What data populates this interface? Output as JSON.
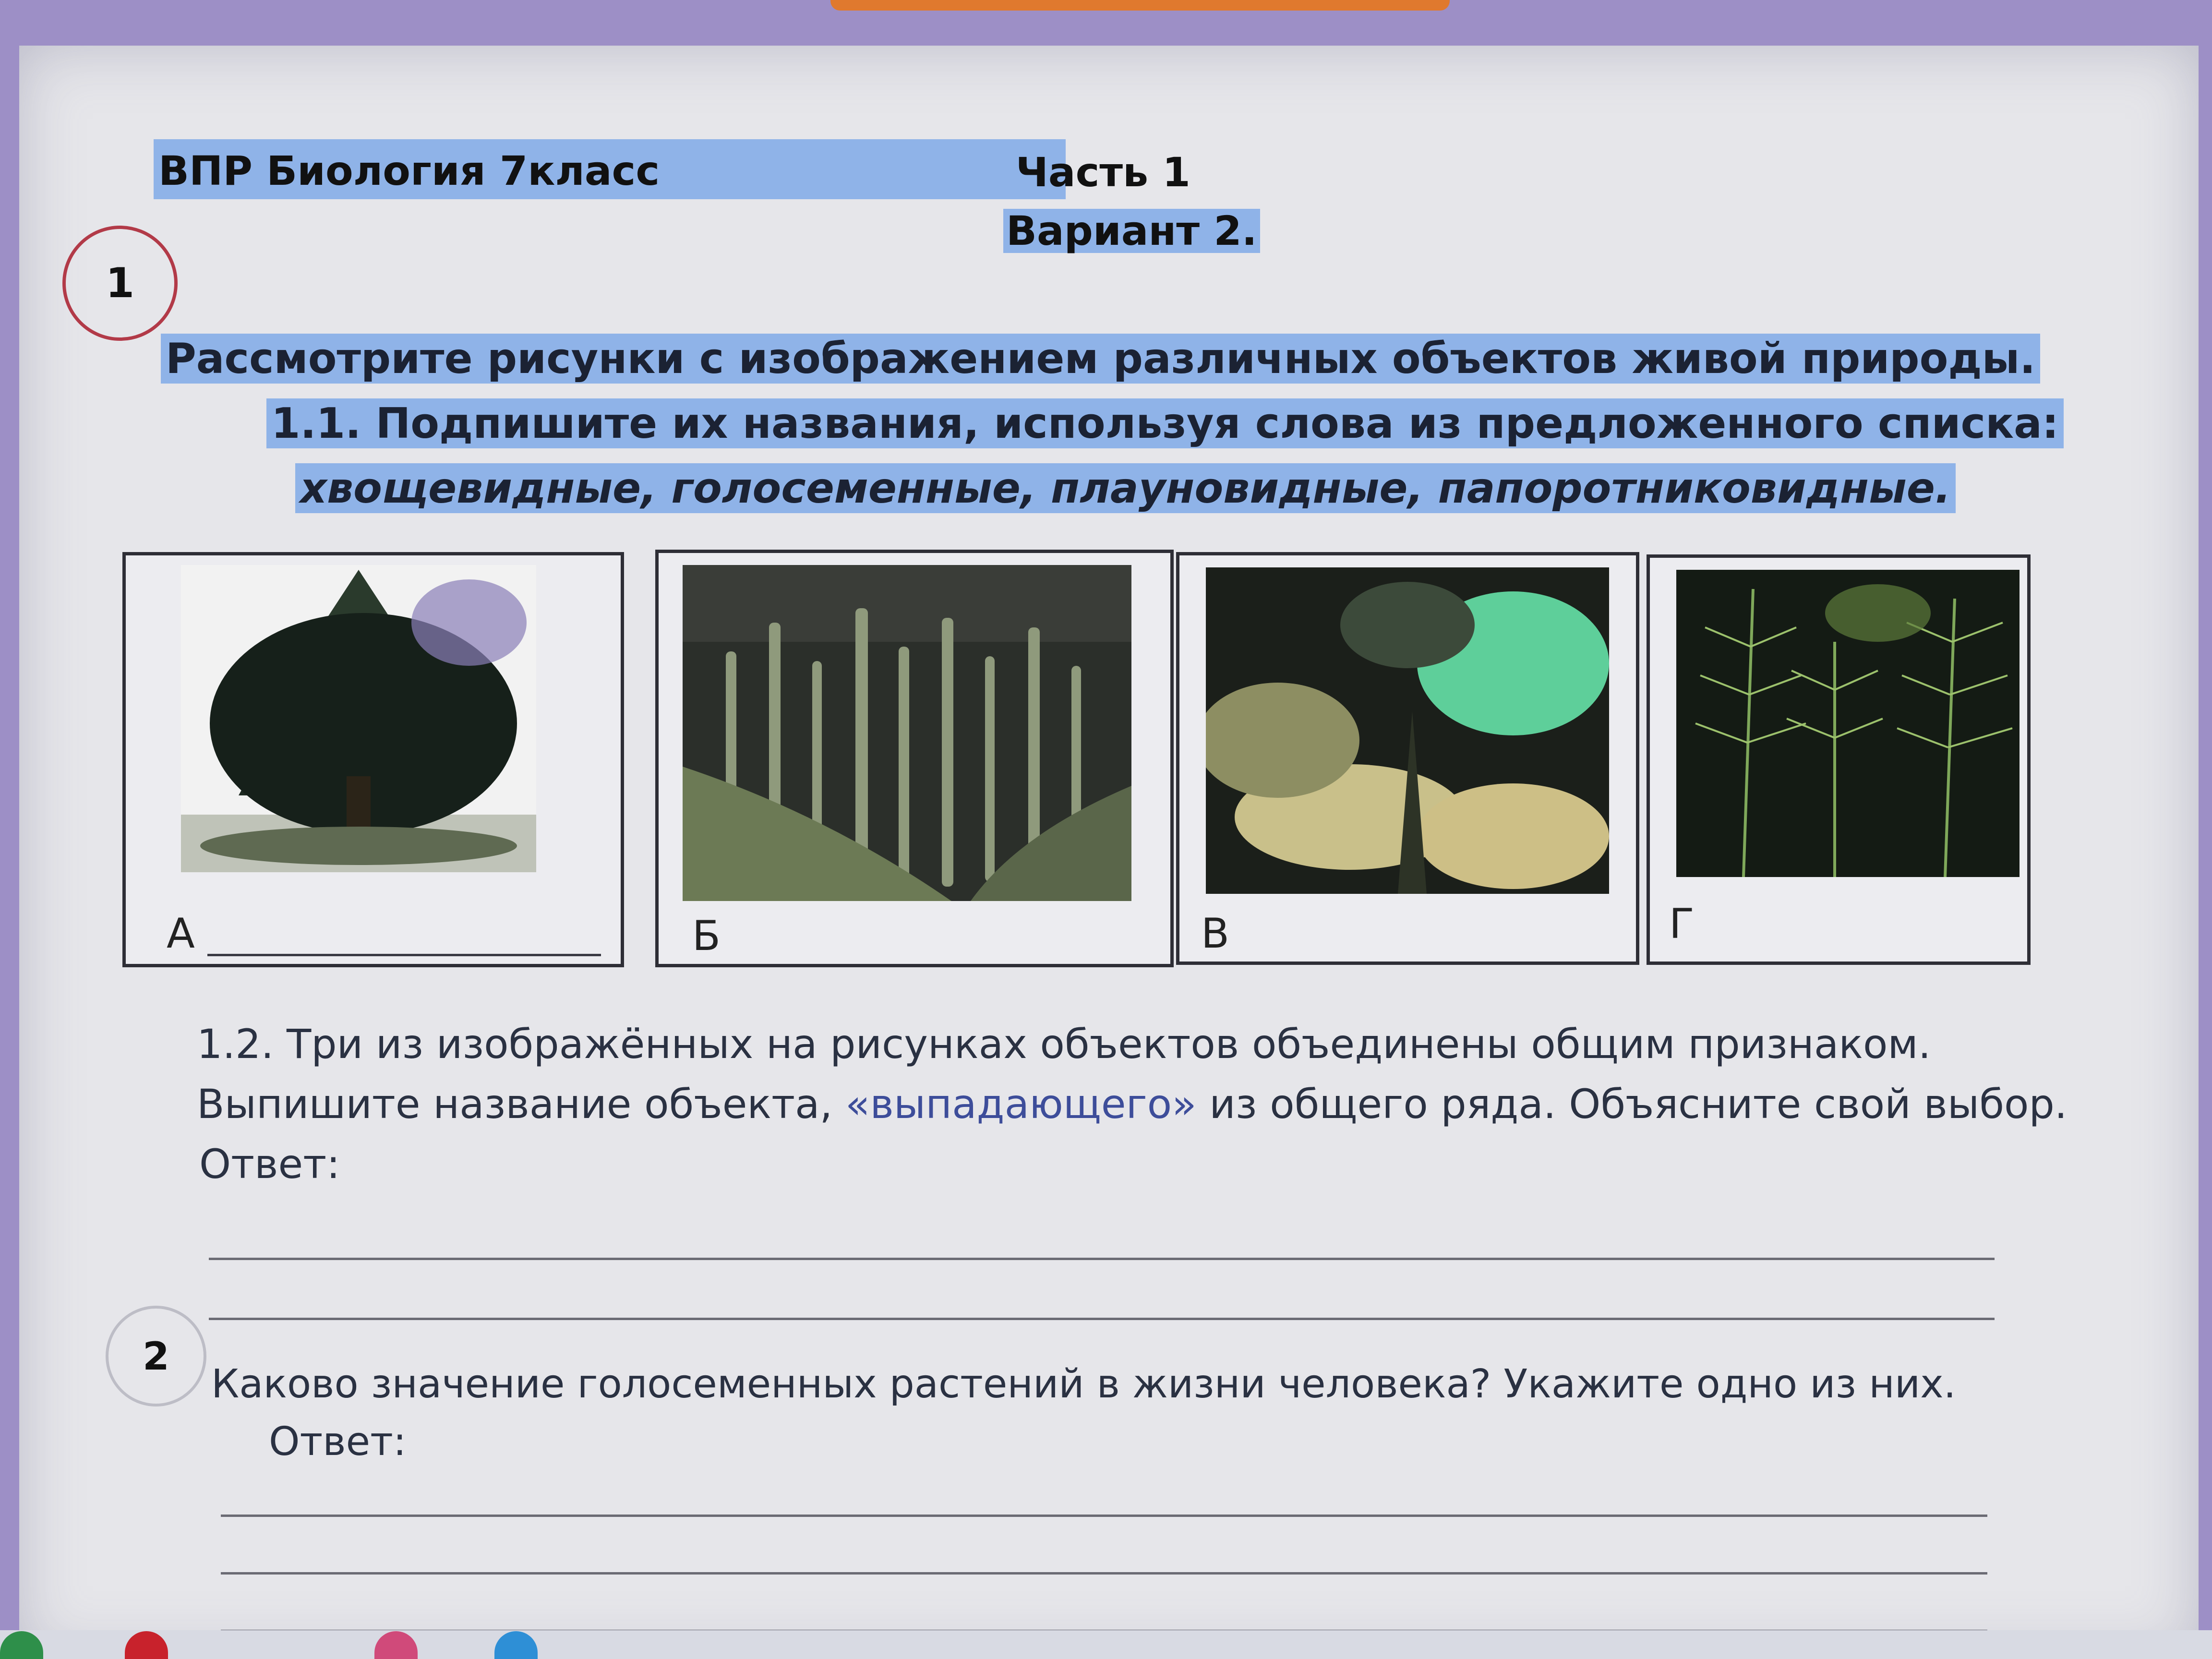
{
  "colors": {
    "highlight": "#8fb3e8",
    "task_circle": "#b23a48",
    "text_dark": "#1b2233",
    "text_blue": "#3d4d9a"
  },
  "header": {
    "left_title": "ВПР Биология 7класс",
    "part": "Часть 1",
    "variant": "Вариант 2."
  },
  "task1": {
    "number": "1",
    "intro": "Рассмотрите рисунки с изображением различных объектов живой природы.",
    "q1_1": "1.1. Подпишите их названия, используя слова из предложенного списка:",
    "word_list": "хвощевидные, голосеменные, плауновидные, папоротниковидные.",
    "cards": [
      {
        "label": "А",
        "image": "conifer-tree"
      },
      {
        "label": "Б",
        "image": "clubmoss-plants"
      },
      {
        "label": "В",
        "image": "fern-fronds"
      },
      {
        "label": "Г",
        "image": "horsetail-plants"
      }
    ],
    "q1_2_line1": "1.2. Три из изображённых на рисунках объектов объединены общим признаком.",
    "q1_2_line2_a": "Выпишите название объекта, ",
    "q1_2_line2_b": "«выпадающего»",
    "q1_2_line2_c": " из общего ряда. Объясните свой выбор.",
    "answer_label": "Ответ:"
  },
  "task2": {
    "number": "2",
    "question": "Каково значение голосеменных растений в жизни человека? Укажите одно из них.",
    "answer_label": "Ответ:"
  }
}
